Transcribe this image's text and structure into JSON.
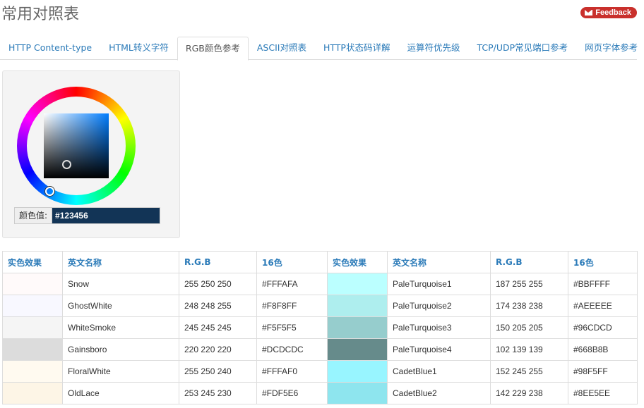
{
  "page": {
    "title": "常用对照表",
    "feedback_label": "Feedback"
  },
  "tabs": [
    {
      "label": "HTTP Content-type",
      "active": false
    },
    {
      "label": "HTML转义字符",
      "active": false
    },
    {
      "label": "RGB颜色参考",
      "active": true
    },
    {
      "label": "ASCII对照表",
      "active": false
    },
    {
      "label": "HTTP状态码详解",
      "active": false
    },
    {
      "label": "运算符优先级",
      "active": false
    },
    {
      "label": "TCP/UDP常见端口参考",
      "active": false
    },
    {
      "label": "网页字体参考",
      "active": false
    }
  ],
  "picker": {
    "label": "颜色值:",
    "value": "#123456"
  },
  "table": {
    "headers": [
      "实色效果",
      "英文名称",
      "R.G.B",
      "16色",
      "实色效果",
      "英文名称",
      "R.G.B",
      "16色"
    ],
    "rows": [
      {
        "left": {
          "color": "#FFFAFA",
          "name": "Snow",
          "rgb": "255 250 250",
          "hex": "#FFFAFA"
        },
        "right": {
          "color": "#BBFFFF",
          "name": "PaleTurquoise1",
          "rgb": "187 255 255",
          "hex": "#BBFFFF"
        }
      },
      {
        "left": {
          "color": "#F8F8FF",
          "name": "GhostWhite",
          "rgb": "248 248 255",
          "hex": "#F8F8FF"
        },
        "right": {
          "color": "#AEEEEE",
          "name": "PaleTurquoise2",
          "rgb": "174 238 238",
          "hex": "#AEEEEE"
        }
      },
      {
        "left": {
          "color": "#F5F5F5",
          "name": "WhiteSmoke",
          "rgb": "245 245 245",
          "hex": "#F5F5F5"
        },
        "right": {
          "color": "#96CDCD",
          "name": "PaleTurquoise3",
          "rgb": "150 205 205",
          "hex": "#96CDCD"
        }
      },
      {
        "left": {
          "color": "#DCDCDC",
          "name": "Gainsboro",
          "rgb": "220 220 220",
          "hex": "#DCDCDC"
        },
        "right": {
          "color": "#668B8B",
          "name": "PaleTurquoise4",
          "rgb": "102 139 139",
          "hex": "#668B8B"
        }
      },
      {
        "left": {
          "color": "#FFFAF0",
          "name": "FloralWhite",
          "rgb": "255 250 240",
          "hex": "#FFFAF0"
        },
        "right": {
          "color": "#98F5FF",
          "name": "CadetBlue1",
          "rgb": "152 245 255",
          "hex": "#98F5FF"
        }
      },
      {
        "left": {
          "color": "#FDF5E6",
          "name": "OldLace",
          "rgb": "253 245 230",
          "hex": "#FDF5E6"
        },
        "right": {
          "color": "#8EE5EE",
          "name": "CadetBlue2",
          "rgb": "142 229 238",
          "hex": "#8EE5EE"
        }
      }
    ]
  }
}
